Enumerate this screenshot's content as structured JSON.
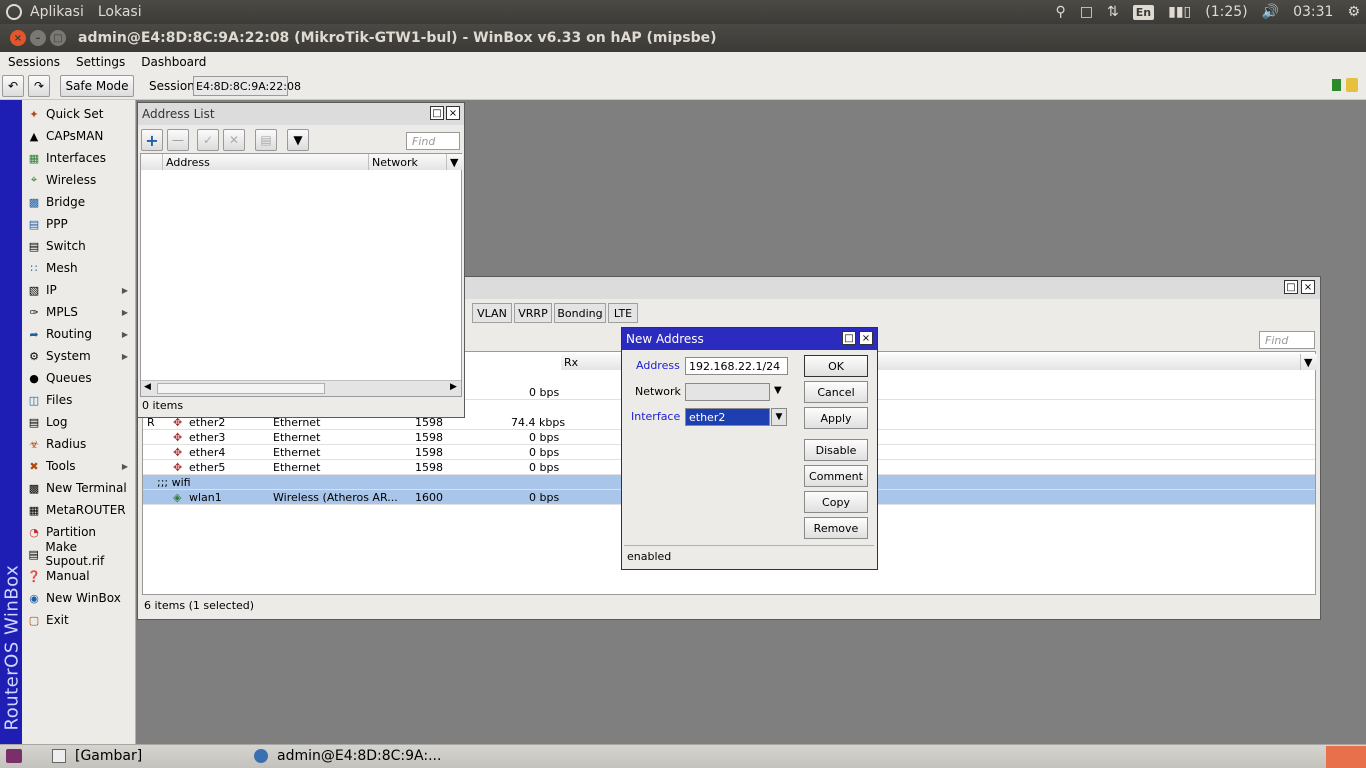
{
  "top_panel": {
    "menu": [
      "Aplikasi",
      "Lokasi"
    ],
    "battery": "(1:25)",
    "keyboard": "En",
    "clock": "03:31"
  },
  "window": {
    "title": "admin@E4:8D:8C:9A:22:08 (MikroTik-GTW1-bul) - WinBox v6.33 on hAP (mipsbe)"
  },
  "menubar": [
    "Sessions",
    "Settings",
    "Dashboard"
  ],
  "toolbar": {
    "safe_mode": "Safe Mode",
    "session_label": "Session:",
    "session_value": "E4:8D:8C:9A:22:08"
  },
  "sidebar": {
    "brand": "RouterOS WinBox",
    "items": [
      {
        "label": "Quick Set",
        "icon": "quickset-icon"
      },
      {
        "label": "CAPsMAN",
        "icon": "capsman-icon"
      },
      {
        "label": "Interfaces",
        "icon": "interfaces-icon"
      },
      {
        "label": "Wireless",
        "icon": "wireless-icon"
      },
      {
        "label": "Bridge",
        "icon": "bridge-icon"
      },
      {
        "label": "PPP",
        "icon": "ppp-icon"
      },
      {
        "label": "Switch",
        "icon": "switch-icon"
      },
      {
        "label": "Mesh",
        "icon": "mesh-icon"
      },
      {
        "label": "IP",
        "icon": "ip-icon"
      },
      {
        "label": "MPLS",
        "icon": "mpls-icon"
      },
      {
        "label": "Routing",
        "icon": "routing-icon"
      },
      {
        "label": "System",
        "icon": "system-icon"
      },
      {
        "label": "Queues",
        "icon": "queues-icon"
      },
      {
        "label": "Files",
        "icon": "files-icon"
      },
      {
        "label": "Log",
        "icon": "log-icon"
      },
      {
        "label": "Radius",
        "icon": "radius-icon"
      },
      {
        "label": "Tools",
        "icon": "tools-icon"
      },
      {
        "label": "New Terminal",
        "icon": "terminal-icon"
      },
      {
        "label": "MetaROUTER",
        "icon": "metarouter-icon"
      },
      {
        "label": "Partition",
        "icon": "partition-icon"
      },
      {
        "label": "Make Supout.rif",
        "icon": "supout-icon"
      },
      {
        "label": "Manual",
        "icon": "manual-icon"
      },
      {
        "label": "New WinBox",
        "icon": "winbox-icon"
      },
      {
        "label": "Exit",
        "icon": "exit-icon"
      }
    ]
  },
  "address_list": {
    "title": "Address List",
    "find_placeholder": "Find",
    "columns": [
      "Address",
      "Network"
    ],
    "status": "0 items"
  },
  "interface_list": {
    "tabs": [
      "VLAN",
      "VRRP",
      "Bonding",
      "LTE"
    ],
    "find_placeholder": "Find",
    "rx_header": "Rx",
    "first_rx": "0 bps",
    "rows": [
      {
        "flag": "R",
        "name": "ether2",
        "type": "Ethernet",
        "mtu": "1598",
        "rx": "74.4 kbps"
      },
      {
        "flag": "",
        "name": "ether3",
        "type": "Ethernet",
        "mtu": "1598",
        "rx": "0 bps"
      },
      {
        "flag": "",
        "name": "ether4",
        "type": "Ethernet",
        "mtu": "1598",
        "rx": "0 bps"
      },
      {
        "flag": "",
        "name": "ether5",
        "type": "Ethernet",
        "mtu": "1598",
        "rx": "0 bps"
      }
    ],
    "comment_row": ";;; wifi",
    "wlan": {
      "name": "wlan1",
      "type": "Wireless (Atheros AR...",
      "mtu": "1600",
      "rx": "0 bps"
    },
    "status": "6 items (1 selected)"
  },
  "new_address": {
    "title": "New Address",
    "address_label": "Address",
    "address_value": "192.168.22.1/24",
    "network_label": "Network",
    "interface_label": "Interface",
    "interface_value": "ether2",
    "buttons": {
      "ok": "OK",
      "cancel": "Cancel",
      "apply": "Apply",
      "disable": "Disable",
      "comment": "Comment",
      "copy": "Copy",
      "remove": "Remove"
    },
    "status": "enabled"
  },
  "taskbar": {
    "items": [
      "[Gambar]",
      "admin@E4:8D:8C:9A:..."
    ]
  },
  "colors": {
    "brand_strip": "#1e1eb4",
    "selection": "#a9c6ea",
    "label_blue": "#2020d0"
  }
}
